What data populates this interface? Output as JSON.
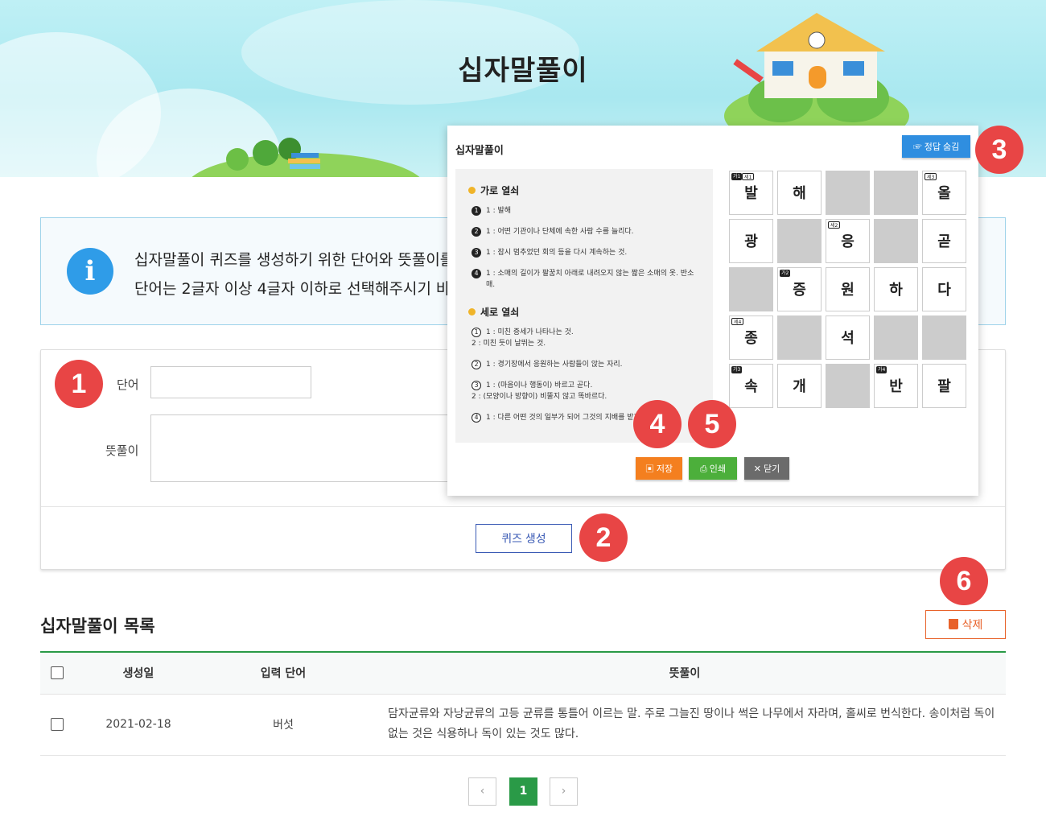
{
  "header": {
    "title": "십자말풀이"
  },
  "info": {
    "line1": "십자말풀이 퀴즈를 생성하기 위한 단어와 뜻풀이를",
    "line2": "단어는 2글자 이상 4글자 이하로 선택해주시기 바"
  },
  "form": {
    "word_label": "단어",
    "word_value": "",
    "meaning_label": "뜻풀이",
    "meaning_value": "",
    "create_button": "퀴즈 생성"
  },
  "list": {
    "title": "십자말풀이 목록",
    "delete_button": "삭제",
    "columns": [
      "생성일",
      "입력 단어",
      "뜻풀이"
    ],
    "rows": [
      {
        "date": "2021-02-18",
        "word": "버섯",
        "meaning": "담자균류와 자낭균류의 고등 균류를 통틀어 이르는 말. 주로 그늘진 땅이나 썩은 나무에서 자라며, 홀씨로 번식한다. 송이처럼 독이 없는 것은 식용하나 독이 있는 것도 많다."
      }
    ]
  },
  "pagination": {
    "prev": "‹",
    "current": "1",
    "next": "›"
  },
  "modal": {
    "title": "십자말풀이",
    "answer_button": "정답 숨김",
    "across_title": "가로 열쇠",
    "across": [
      {
        "n": "1",
        "text": "1 : 발해"
      },
      {
        "n": "2",
        "text": "1 : 어떤 기관이나 단체에 속한 사람 수를 늘리다."
      },
      {
        "n": "3",
        "text": "1 : 잠시 멈추었던 회의 등을 다시 계속하는 것."
      },
      {
        "n": "4",
        "text": "1 : 소매의 길이가 팔꿈치 아래로 내려오지 않는 짧은 소매의 옷. 반소매."
      }
    ],
    "down_title": "세로 열쇠",
    "down": [
      {
        "n": "1",
        "text": "1 : 미친 증세가 나타나는 것.",
        "sub": "2 : 미친 듯이 날뛰는 것."
      },
      {
        "n": "2",
        "text": "1 : 경기장에서 응원하는 사람들이 앉는 자리.",
        "sub": ""
      },
      {
        "n": "3",
        "text": "1 : (마음이나 행동이) 바르고 곧다.",
        "sub": "2 : (모양이나 방향이) 비뚤지 않고 똑바르다."
      },
      {
        "n": "4",
        "text": "1 : 다른 어떤 것의 일부가 되어 그것의 지배를 받거나",
        "sub": ""
      }
    ],
    "grid": [
      [
        "발",
        "해",
        "",
        "",
        "올"
      ],
      [
        "광",
        "",
        "응",
        "",
        "곧"
      ],
      [
        "",
        "증",
        "원",
        "하",
        "다"
      ],
      [
        "종",
        "",
        "석",
        "",
        ""
      ],
      [
        "속",
        "개",
        "",
        "반",
        "팔"
      ]
    ],
    "grid_tags": [
      {
        "r": 0,
        "c": 0,
        "h": "가1",
        "v": "세1"
      },
      {
        "r": 0,
        "c": 4,
        "v": "세3"
      },
      {
        "r": 1,
        "c": 2,
        "v": "세2"
      },
      {
        "r": 2,
        "c": 1,
        "h": "가2"
      },
      {
        "r": 3,
        "c": 0,
        "v": "세4"
      },
      {
        "r": 4,
        "c": 0,
        "h": "가3"
      },
      {
        "r": 4,
        "c": 3,
        "h": "가4"
      }
    ],
    "save_button": "저장",
    "print_button": "인쇄",
    "close_button": "닫기"
  },
  "callouts": [
    "1",
    "2",
    "3",
    "4",
    "5",
    "6"
  ],
  "colors": {
    "accent_green": "#2a9a47",
    "callout_red": "#e84545",
    "save_orange": "#f47f1f",
    "print_green": "#4caf3b",
    "close_gray": "#6b6b6b",
    "answer_blue": "#2f8ee0"
  }
}
